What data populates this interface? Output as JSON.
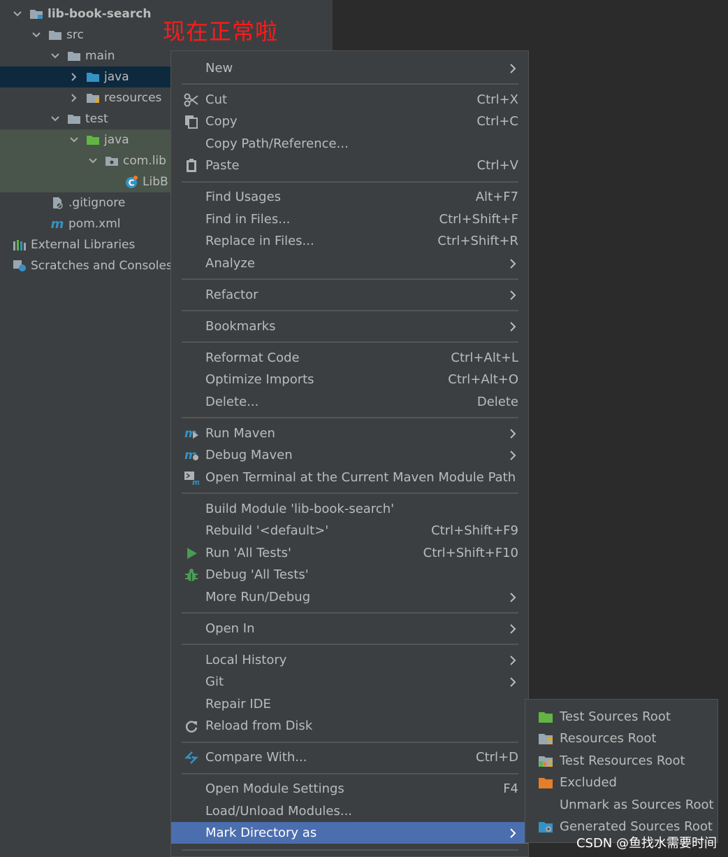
{
  "annotation": "现在正常啦",
  "tree": {
    "root": "lib-book-search",
    "src": "src",
    "main": "main",
    "main_java": "java",
    "resources": "resources",
    "test": "test",
    "test_java": "java",
    "package": "com.lib",
    "class_file": "LibB",
    "gitignore": ".gitignore",
    "pom": "pom.xml",
    "external_libraries": "External Libraries",
    "scratches": "Scratches and Consoles"
  },
  "menu": {
    "new": "New",
    "cut": "Cut",
    "cut_sc": "Ctrl+X",
    "copy": "Copy",
    "copy_sc": "Ctrl+C",
    "copy_path": "Copy Path/Reference...",
    "paste": "Paste",
    "paste_sc": "Ctrl+V",
    "find_usages": "Find Usages",
    "find_usages_sc": "Alt+F7",
    "find_in_files": "Find in Files...",
    "find_in_files_sc": "Ctrl+Shift+F",
    "replace_in_files": "Replace in Files...",
    "replace_in_files_sc": "Ctrl+Shift+R",
    "analyze": "Analyze",
    "refactor": "Refactor",
    "bookmarks": "Bookmarks",
    "reformat": "Reformat Code",
    "reformat_sc": "Ctrl+Alt+L",
    "optimize": "Optimize Imports",
    "optimize_sc": "Ctrl+Alt+O",
    "delete": "Delete...",
    "delete_sc": "Delete",
    "run_maven": "Run Maven",
    "debug_maven": "Debug Maven",
    "open_terminal": "Open Terminal at the Current Maven Module Path",
    "build_module": "Build Module 'lib-book-search'",
    "rebuild": "Rebuild '<default>'",
    "rebuild_sc": "Ctrl+Shift+F9",
    "run_tests": "Run 'All Tests'",
    "run_tests_sc": "Ctrl+Shift+F10",
    "debug_tests": "Debug 'All Tests'",
    "more_run": "More Run/Debug",
    "open_in": "Open In",
    "local_history": "Local History",
    "git": "Git",
    "repair_ide": "Repair IDE",
    "reload": "Reload from Disk",
    "compare": "Compare With...",
    "compare_sc": "Ctrl+D",
    "module_settings": "Open Module Settings",
    "module_settings_sc": "F4",
    "load_unload": "Load/Unload Modules...",
    "mark_dir": "Mark Directory as"
  },
  "submenu": {
    "test_sources": "Test Sources Root",
    "resources_root": "Resources Root",
    "test_resources": "Test Resources Root",
    "excluded": "Excluded",
    "unmark": "Unmark as Sources Root",
    "generated": "Generated Sources Root"
  },
  "watermark": "CSDN @鱼找水需要时间",
  "colors": {
    "selection": "#4b6eaf",
    "folder_gray": "#9aa7b0",
    "folder_blue": "#3592c4",
    "folder_green": "#62b543",
    "excluded_orange": "#e57e2a",
    "annotation_red": "#ff1a1a"
  }
}
